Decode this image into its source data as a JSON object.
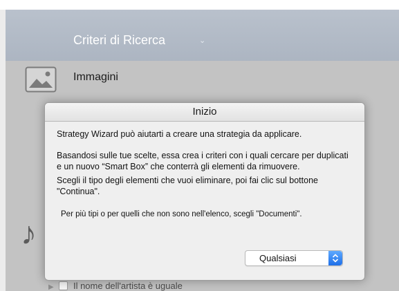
{
  "header": {
    "title": "Criteri di Ricerca",
    "chevron_icon": "chevron-down-icon"
  },
  "content": {
    "image_row_label": "Immagini",
    "image_icon": "image-icon",
    "music_icon": "music-note-icon",
    "bottom_row_label": "Il nome dell'artista è uguale"
  },
  "dialog": {
    "title": "Inizio",
    "paragraph1": "Strategy Wizard può aiutarti a creare una strategia da applicare.",
    "paragraph2": "Basandosi sulle tue scelte, essa crea i criteri con i quali cercare per duplicati e un nuovo “Smart Box” che conterrà gli elementi da rimuovere.",
    "paragraph3": "Scegli il tipo degli elementi che vuoi eliminare, poi fai clic sul bottone \"Continua\".",
    "note": "Per più tipi o per quelli che non sono nell'elenco, scegli \"Documenti\".",
    "select": {
      "value": "Qualsiasi",
      "icon": "up-down-chevron-icon"
    }
  },
  "colors": {
    "header_bg": "#b9c1cc",
    "content_bg": "#c3c3c3",
    "accent": "#2a7cf0"
  }
}
